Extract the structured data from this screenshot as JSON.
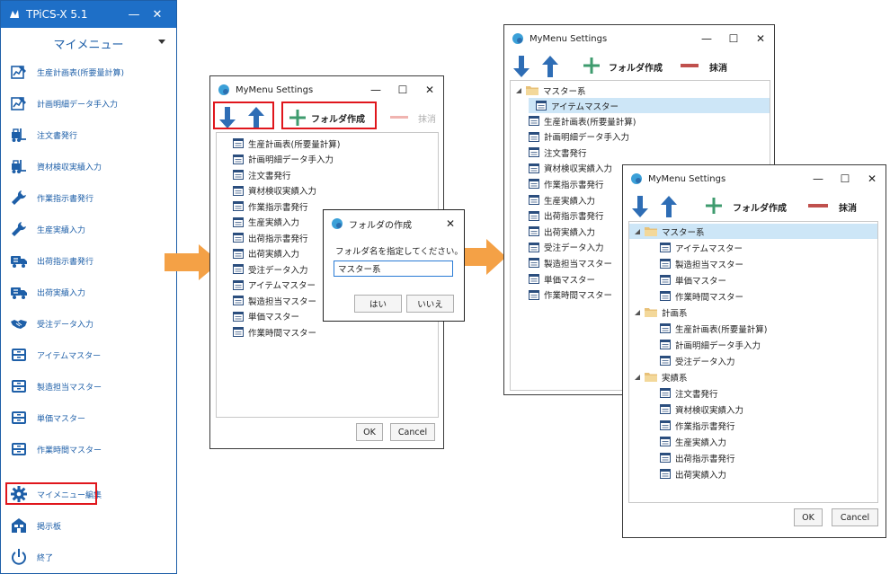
{
  "tpics": {
    "title": "TPiCS-X 5.1",
    "minimize": "—",
    "close": "✕",
    "header": "マイメニュー",
    "items": [
      {
        "label": "生産計画表(所要量計算)",
        "icon": "chart-edit-icon"
      },
      {
        "label": "計画明細データ手入力",
        "icon": "chart-edit-icon"
      },
      {
        "label": "注文書発行",
        "icon": "forklift-icon"
      },
      {
        "label": "資材検収実績入力",
        "icon": "forklift-icon"
      },
      {
        "label": "作業指示書発行",
        "icon": "wrench-icon"
      },
      {
        "label": "生産実績入力",
        "icon": "wrench-icon"
      },
      {
        "label": "出荷指示書発行",
        "icon": "truck-icon"
      },
      {
        "label": "出荷実績入力",
        "icon": "truck-icon"
      },
      {
        "label": "受注データ入力",
        "icon": "handshake-icon"
      },
      {
        "label": "アイテムマスター",
        "icon": "inbox-icon"
      },
      {
        "label": "製造担当マスター",
        "icon": "inbox-icon"
      },
      {
        "label": "単価マスター",
        "icon": "inbox-icon"
      },
      {
        "label": "作業時間マスター",
        "icon": "inbox-icon"
      },
      {
        "label": "マイメニュー編集",
        "icon": "gear-icon"
      },
      {
        "label": "掲示板",
        "icon": "board-icon"
      },
      {
        "label": "終了",
        "icon": "power-icon"
      }
    ]
  },
  "window1": {
    "title": "MyMenu Settings",
    "controls": {
      "minimize": "—",
      "maximize": "☐",
      "close": "✕"
    },
    "toolbar": {
      "create_folder": "フォルダ作成",
      "delete": "抹消"
    },
    "items": [
      "生産計画表(所要量計算)",
      "計画明細データ手入力",
      "注文書発行",
      "資材検収実績入力",
      "作業指示書発行",
      "生産実績入力",
      "出荷指示書発行",
      "出荷実績入力",
      "受注データ入力",
      "アイテムマスター",
      "製造担当マスター",
      "単価マスター",
      "作業時間マスター"
    ],
    "ok": "OK",
    "cancel": "Cancel"
  },
  "dialog": {
    "title": "フォルダの作成",
    "close": "✕",
    "prompt": "フォルダ名を指定してください。",
    "value": "マスター系",
    "yes": "はい",
    "no": "いいえ"
  },
  "window2": {
    "title": "MyMenu Settings",
    "controls": {
      "minimize": "—",
      "maximize": "☐",
      "close": "✕"
    },
    "toolbar": {
      "create_folder": "フォルダ作成",
      "delete": "抹消"
    },
    "folder": "マスター系",
    "folder_child": "アイテムマスター",
    "items": [
      "生産計画表(所要量計算)",
      "計画明細データ手入力",
      "注文書発行",
      "資材検収実績入力",
      "作業指示書発行",
      "生産実績入力",
      "出荷指示書発行",
      "出荷実績入力",
      "受注データ入力",
      "製造担当マスター",
      "単価マスター",
      "作業時間マスター"
    ]
  },
  "window3": {
    "title": "MyMenu Settings",
    "controls": {
      "minimize": "—",
      "maximize": "☐",
      "close": "✕"
    },
    "toolbar": {
      "create_folder": "フォルダ作成",
      "delete": "抹消"
    },
    "folders": [
      {
        "name": "マスター系",
        "children": [
          "アイテムマスター",
          "製造担当マスター",
          "単価マスター",
          "作業時間マスター"
        ]
      },
      {
        "name": "計画系",
        "children": [
          "生産計画表(所要量計算)",
          "計画明細データ手入力",
          "受注データ入力"
        ]
      },
      {
        "name": "実績系",
        "children": [
          "注文書発行",
          "資材検収実績入力",
          "作業指示書発行",
          "生産実績入力",
          "出荷指示書発行",
          "出荷実績入力"
        ]
      }
    ],
    "ok": "OK",
    "cancel": "Cancel"
  },
  "colors": {
    "accent": "#1e6fc7",
    "arrow_orange": "#f4a146",
    "highlight": "#e0161c",
    "up_down": "#2e6db5",
    "plus_green": "#3e9b6e",
    "minus_red": "#c0504d",
    "selection": "#cde6f7"
  }
}
